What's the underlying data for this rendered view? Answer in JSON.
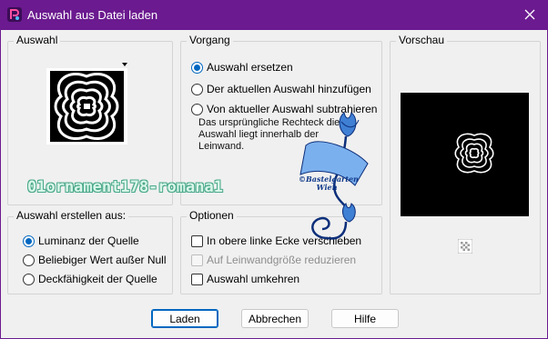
{
  "window": {
    "title": "Auswahl aus Datei laden",
    "title_bar_color": "#6b1a8f",
    "app_icon": "paintshop-pro-icon",
    "close_icon": "close-icon"
  },
  "auswahl": {
    "label": "Auswahl"
  },
  "vorgang": {
    "label": "Vorgang",
    "options": [
      {
        "label": "Auswahl ersetzen",
        "checked": true
      },
      {
        "label": "Der aktuellen Auswahl hinzufügen",
        "checked": false
      },
      {
        "label": "Von aktueller Auswahl subtrahieren",
        "checked": false
      }
    ],
    "info": "Das ursprüngliche Rechteck dieser Auswahl liegt innerhalb der Leinwand."
  },
  "vorschau": {
    "label": "Vorschau"
  },
  "auswahl_erstellen": {
    "label": "Auswahl erstellen aus:",
    "options": [
      {
        "label": "Luminanz der Quelle",
        "checked": true
      },
      {
        "label": "Beliebiger Wert außer Null",
        "checked": false
      },
      {
        "label": "Deckfähigkeit der Quelle",
        "checked": false
      }
    ]
  },
  "optionen": {
    "label": "Optionen",
    "checks": [
      {
        "label": "In obere linke Ecke verschieben",
        "checked": false,
        "enabled": true
      },
      {
        "label": "Auf Leinwandgröße reduzieren",
        "checked": false,
        "enabled": false
      },
      {
        "label": "Auswahl umkehren",
        "checked": false,
        "enabled": true
      }
    ]
  },
  "buttons": {
    "load": "Laden",
    "cancel": "Abbrechen",
    "help": "Hilfe"
  },
  "watermark": {
    "filename": "01ornament178-romana1",
    "tag_line1": "©Bastelgarten",
    "tag_line2": "Wien"
  },
  "colors": {
    "accent": "#0067c0",
    "window_bg": "#f0f0f0",
    "group_border": "#d4d4d4"
  }
}
